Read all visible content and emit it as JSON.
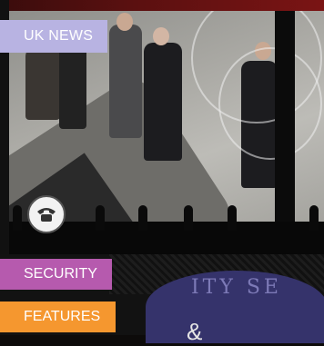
{
  "badge": {
    "label": "UK NEWS",
    "color": "#b8b3e2"
  },
  "photo": {
    "icon": "phone-icon"
  },
  "sections": [
    {
      "label": "SECURITY",
      "color": "#b65aae"
    },
    {
      "label": "FEATURES",
      "color": "#f5972f"
    }
  ],
  "seal": {
    "text": "ITY SE"
  },
  "logo": {
    "glyph": "&"
  }
}
